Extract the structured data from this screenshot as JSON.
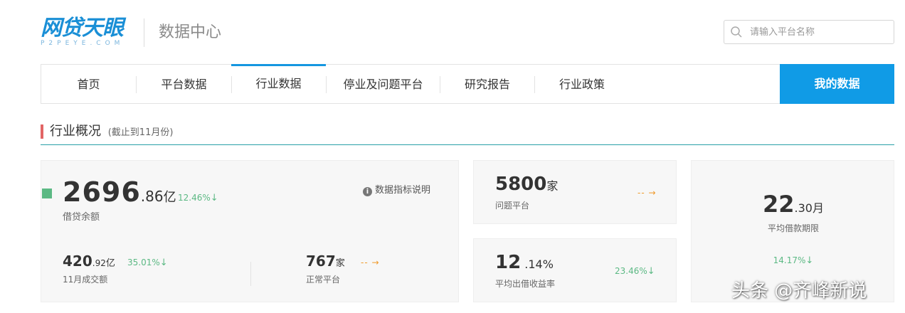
{
  "brand": {
    "logo_text": "网贷天眼",
    "logo_sub": "P2PEYE.COM",
    "site_title": "数据中心",
    "accent": "#109be6"
  },
  "search": {
    "placeholder": "请输入平台名称",
    "icon": "search-icon"
  },
  "nav": {
    "items": [
      {
        "label": "首页"
      },
      {
        "label": "平台数据"
      },
      {
        "label": "行业数据",
        "active": true
      },
      {
        "label": "停业及问题平台"
      },
      {
        "label": "研究报告"
      },
      {
        "label": "行业政策"
      }
    ],
    "mine_label": "我的数据"
  },
  "section": {
    "title": "行业概况",
    "note": "(截止到11月份)"
  },
  "overview": {
    "loan_balance": {
      "int": "2696",
      "dec": ".86",
      "unit": "亿",
      "label": "借贷余额",
      "change": "12.46%",
      "trend": "down"
    },
    "info_label": "数据指标说明",
    "monthly_volume": {
      "int": "420",
      "dec": ".92",
      "unit": "亿",
      "label": "11月成交额",
      "change": "35.01%",
      "trend": "down"
    },
    "normal_platforms": {
      "int": "767",
      "unit": "家",
      "label": "正常平台",
      "change": "-- →",
      "trend": "flat"
    },
    "problem_platforms": {
      "int": "5800",
      "unit": "家",
      "label": "问题平台",
      "change": "-- →",
      "trend": "flat"
    },
    "avg_yield": {
      "int": "12",
      "dec": " .14",
      "unit": "%",
      "label": "平均出借收益率",
      "change": "23.46%",
      "trend": "down"
    },
    "avg_term": {
      "int": "22",
      "dec": ".30",
      "unit": "月",
      "label": "平均借款期限",
      "change": "14.17%",
      "trend": "down"
    },
    "colors": {
      "down": "#5cb984",
      "flat": "#f09a2a",
      "marker": "#5cb984",
      "section_bar": "#e26565"
    }
  },
  "watermark": "头条 @齐峰新说"
}
